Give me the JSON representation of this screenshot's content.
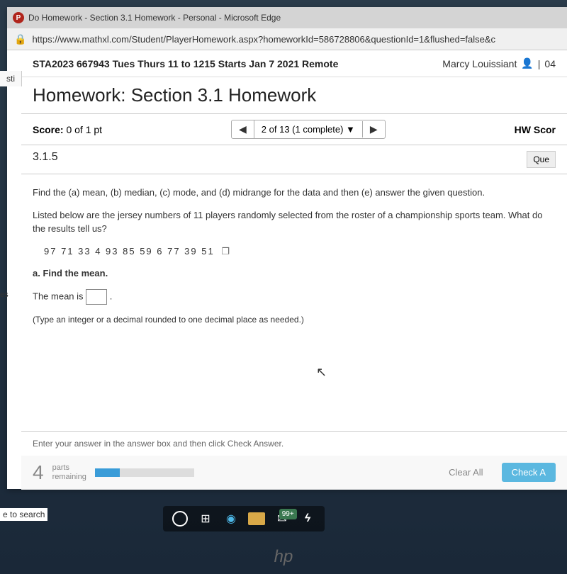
{
  "browser": {
    "tab_title": "Do Homework - Section 3.1 Homework - Personal - Microsoft Edge",
    "url": "https://www.mathxl.com/Student/PlayerHomework.aspx?homeworkId=586728806&questionId=1&flushed=false&c"
  },
  "header": {
    "course": "STA2023 667943 Tues Thurs 11 to 1215 Starts Jan 7 2021 Remote",
    "user": "Marcy Louissiant",
    "divider": "|",
    "date_frag": "04"
  },
  "left_tab": "sti",
  "left_es": "es",
  "homework": {
    "title": "Homework: Section 3.1 Homework",
    "score_label": "Score:",
    "score_value": "0 of 1 pt",
    "nav_text": "2 of 13 (1 complete)",
    "hw_score_label": "HW Scor",
    "question_num": "3.1.5",
    "que_btn": "Que"
  },
  "question": {
    "intro": "Find the (a) mean, (b) median, (c) mode, and (d) midrange for the data and then (e) answer the given question.",
    "desc": "Listed below are the jersey numbers of 11 players randomly selected from the roster of a championship sports team. What do the results tell us?",
    "data": "97   71   33   4   93   85   59   6   77   39   51",
    "part_a": "a. Find the mean.",
    "answer_stem": "The mean is",
    "period": ".",
    "hint": "(Type an integer or a decimal rounded to one decimal place as needed.)"
  },
  "footer": {
    "prompt": "Enter your answer in the answer box and then click Check Answer.",
    "parts_num": "4",
    "parts_label1": "parts",
    "parts_label2": "remaining",
    "clear": "Clear All",
    "check": "Check A"
  },
  "taskbar": {
    "search": "e to search",
    "badge": "99+"
  },
  "hp": "hp"
}
